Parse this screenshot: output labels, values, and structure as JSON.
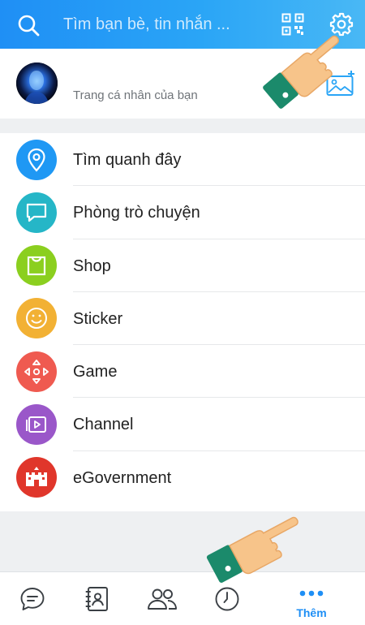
{
  "header": {
    "search_placeholder": "Tìm bạn bè, tin nhắn ...",
    "icons": [
      "search-icon",
      "qr-code-icon",
      "gear-icon"
    ]
  },
  "profile": {
    "caption": "Trang cá nhân của bạn",
    "icons": [
      "avatar",
      "add-cover-photo-icon"
    ]
  },
  "menu": {
    "items": [
      {
        "label": "Tìm quanh đây",
        "icon": "location-pin-icon",
        "color": "#1f98f4"
      },
      {
        "label": "Phòng trò chuyện",
        "icon": "chat-room-icon",
        "color": "#25b6c7"
      },
      {
        "label": "Shop",
        "icon": "shopping-bag-icon",
        "color": "#8bcf1f"
      },
      {
        "label": "Sticker",
        "icon": "smiley-icon",
        "color": "#f2b134"
      },
      {
        "label": "Game",
        "icon": "gamepad-arrows-icon",
        "color": "#ef5a50"
      },
      {
        "label": "Channel",
        "icon": "video-channel-icon",
        "color": "#9a57c9"
      },
      {
        "label": "eGovernment",
        "icon": "government-building-icon",
        "color": "#e0362b"
      }
    ]
  },
  "bottom_nav": {
    "tabs": [
      {
        "name": "messages",
        "icon": "chat-bubble-icon"
      },
      {
        "name": "contacts",
        "icon": "contact-book-icon"
      },
      {
        "name": "groups",
        "icon": "people-icon"
      },
      {
        "name": "timeline",
        "icon": "clock-icon"
      },
      {
        "name": "more",
        "icon": "more-dots-icon",
        "label": "Thêm",
        "active": true
      }
    ],
    "active_color": "#1f8ff5"
  }
}
